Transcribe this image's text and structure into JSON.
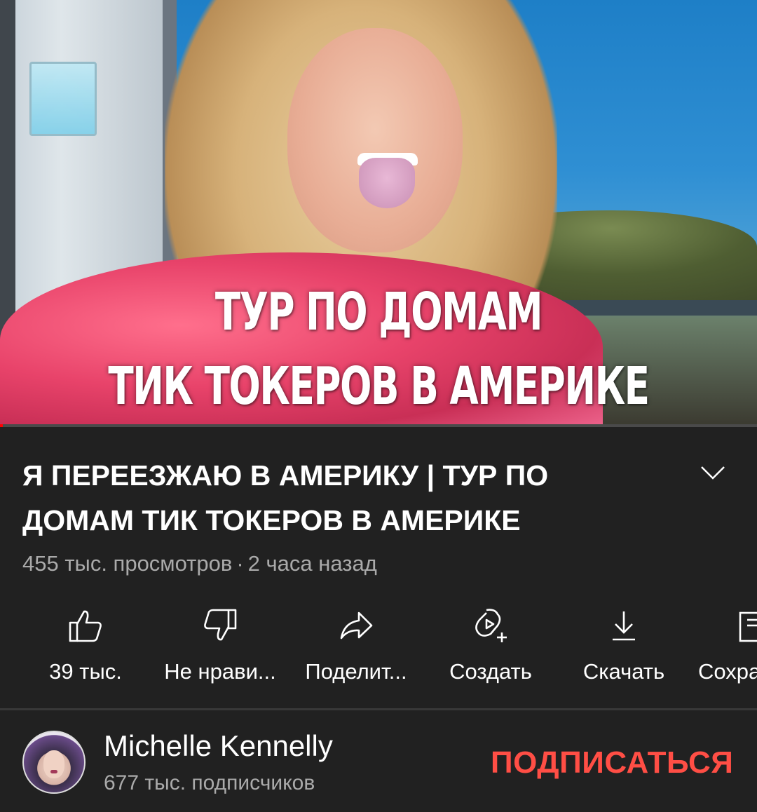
{
  "video": {
    "overlay_line1": "ТУР ПО ДОМАМ",
    "overlay_line2": "ТИК ТОКЕРОВ В АМЕРИКЕ",
    "progress_fraction": 0.003
  },
  "info": {
    "title": "Я ПЕРЕЕЗЖАЮ В АМЕРИКУ | ТУР ПО ДОМАМ ТИК ТОКЕРОВ В АМЕРИКЕ",
    "views": "455 тыс. просмотров",
    "separator": "·",
    "age": "2 часа назад"
  },
  "actions": [
    {
      "icon": "thumbs-up-icon",
      "label": "39 тыс."
    },
    {
      "icon": "thumbs-down-icon",
      "label": "Не нрави..."
    },
    {
      "icon": "share-icon",
      "label": "Поделит..."
    },
    {
      "icon": "create-icon",
      "label": "Создать"
    },
    {
      "icon": "download-icon",
      "label": "Скачать"
    },
    {
      "icon": "save-icon",
      "label": "Сохра"
    }
  ],
  "channel": {
    "name": "Michelle Kennelly",
    "subscribers": "677 тыс. подписчиков",
    "subscribe_label": "ПОДПИСАТЬСЯ"
  },
  "colors": {
    "background": "#212121",
    "secondary_text": "#aaaaaa",
    "subscribe": "#ff4e45",
    "progress": "#ff0000"
  }
}
